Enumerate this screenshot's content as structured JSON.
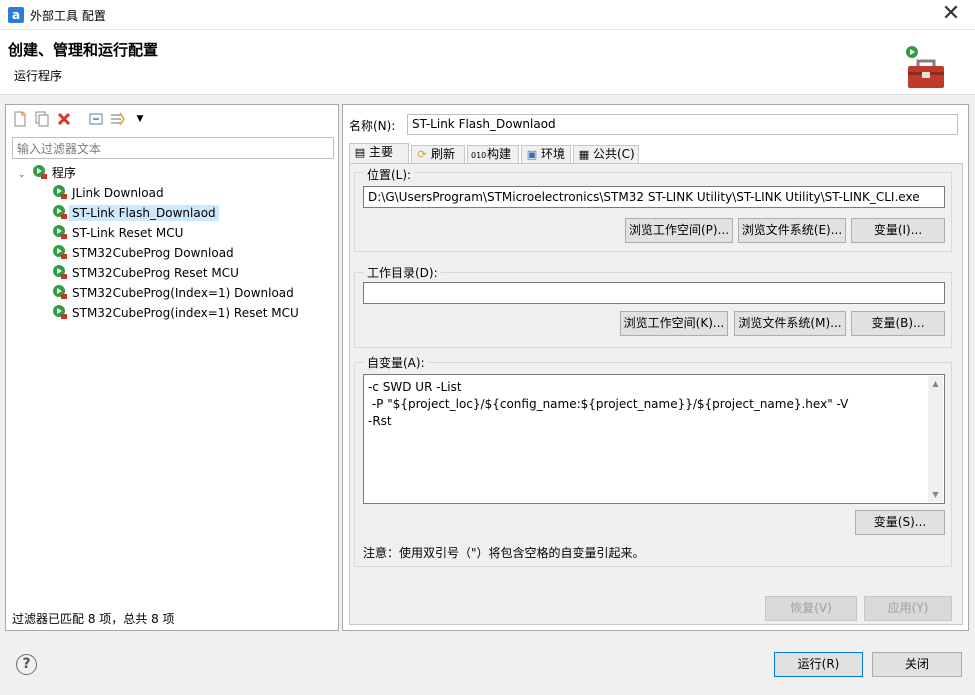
{
  "window": {
    "title": "外部工具 配置",
    "close_glyph": "✕"
  },
  "header": {
    "title": "创建、管理和运行配置",
    "subtitle": "运行程序"
  },
  "colors": {
    "selection_bg": "#cce8ff",
    "primary_border": "#0078d7",
    "launch_green": "#2e9e3e",
    "toolbox_red": "#c0392b"
  },
  "left": {
    "filter_placeholder": "输入过滤器文本",
    "tree_root": "程序",
    "tree_items": [
      "JLink Download",
      "ST-Link Flash_Downlaod",
      "ST-Link Reset MCU",
      "STM32CubeProg Download",
      "STM32CubeProg Reset MCU",
      "STM32CubeProg(Index=1) Download",
      "STM32CubeProg(index=1) Reset MCU"
    ],
    "selected_item": "ST-Link Flash_Downlaod",
    "status": "过滤器已匹配 8 项，总共 8 项"
  },
  "right": {
    "name_label": "名称(N):",
    "name_value": "ST-Link Flash_Downlaod",
    "tabs": [
      {
        "label": "主要",
        "icon": "main-tab-icon"
      },
      {
        "label": "刷新",
        "icon": "refresh-tab-icon"
      },
      {
        "label": "构建",
        "icon": "build-tab-icon"
      },
      {
        "label": "环境",
        "icon": "environment-tab-icon"
      },
      {
        "label": "公共(C)",
        "icon": "common-tab-icon"
      }
    ],
    "location": {
      "label": "位置(L):",
      "value": "D:\\G\\UsersProgram\\STMicroelectronics\\STM32 ST-LINK Utility\\ST-LINK Utility\\ST-LINK_CLI.exe",
      "btn_workspace": "浏览工作空间(P)...",
      "btn_filesystem": "浏览文件系统(E)...",
      "btn_variables": "变量(I)..."
    },
    "workdir": {
      "label": "工作目录(D):",
      "value": "",
      "btn_workspace": "浏览工作空间(K)...",
      "btn_filesystem": "浏览文件系统(M)...",
      "btn_variables": "变量(B)..."
    },
    "arguments": {
      "label": "自变量(A):",
      "value": "-c SWD UR -List\n -P \"${project_loc}/${config_name:${project_name}}/${project_name}.hex\" -V\n-Rst",
      "btn_variables": "变量(S)...",
      "note": "注意：使用双引号（\"）将包含空格的自变量引起来。"
    },
    "btn_revert": "恢复(V)",
    "btn_apply": "应用(Y)"
  },
  "footer": {
    "help": "?",
    "btn_run": "运行(R)",
    "btn_close": "关闭"
  }
}
